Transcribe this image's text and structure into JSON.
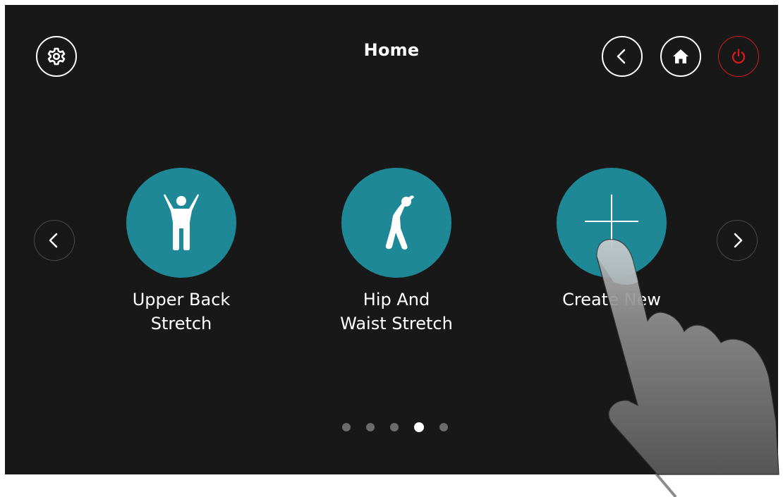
{
  "header": {
    "title": "Home",
    "settings_icon": "gear-icon",
    "back_icon": "chevron-left-icon",
    "home_icon": "home-icon",
    "power_icon": "power-icon"
  },
  "carousel": {
    "prev_icon": "chevron-left-icon",
    "next_icon": "chevron-right-icon",
    "tiles": [
      {
        "line1": "Upper Back",
        "line2": "Stretch",
        "icon": "person-arms-up-icon"
      },
      {
        "line1": "Hip And",
        "line2": "Waist Stretch",
        "icon": "person-side-bend-icon"
      },
      {
        "line1": "Create New",
        "line2": "",
        "icon": "plus-icon"
      }
    ],
    "page_count": 5,
    "current_page": 4
  },
  "colors": {
    "background": "#181818",
    "tile": "#1f8896",
    "power": "#d01a1a",
    "dot_inactive": "#6b6b6b",
    "dot_active": "#ffffff"
  }
}
